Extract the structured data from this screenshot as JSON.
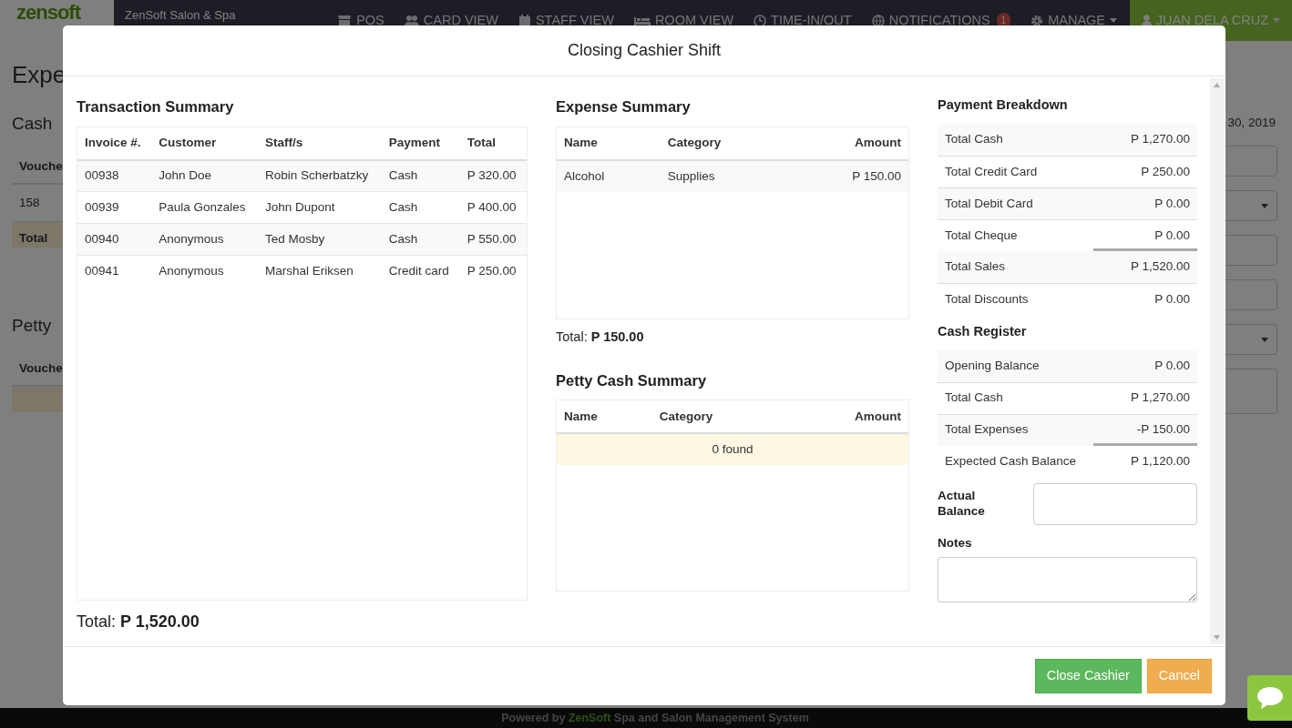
{
  "navbar": {
    "logo": "zensoft",
    "brand": "ZenSoft Salon & Spa",
    "items": [
      {
        "label": "POS"
      },
      {
        "label": "CARD VIEW"
      },
      {
        "label": "STAFF VIEW"
      },
      {
        "label": "ROOM VIEW"
      },
      {
        "label": "TIME-IN/OUT"
      },
      {
        "label": "NOTIFICATIONS",
        "badge": "1"
      },
      {
        "label": "MANAGE",
        "dropdown": true
      }
    ],
    "user": {
      "name": "JUAN DELA CRUZ",
      "dropdown": true
    }
  },
  "background_page": {
    "title": "Expe",
    "date": "30, 2019",
    "sections": [
      {
        "title": "Cash",
        "header": "Vouche",
        "rows": [
          "158"
        ],
        "total_label": "Total"
      },
      {
        "title": "Petty",
        "header": "Vouche",
        "empty_notice": true
      }
    ],
    "form_controls": [
      {
        "kind": "input"
      },
      {
        "kind": "select"
      },
      {
        "kind": "input"
      },
      {
        "kind": "input"
      },
      {
        "kind": "select"
      },
      {
        "kind": "textarea"
      }
    ]
  },
  "modal": {
    "title": "Closing Cashier Shift",
    "transaction_summary": {
      "title": "Transaction Summary",
      "columns": [
        {
          "label": "Invoice #."
        },
        {
          "label": "Customer"
        },
        {
          "label": "Staff/s"
        },
        {
          "label": "Payment"
        },
        {
          "label": "Total"
        }
      ],
      "rows": [
        [
          "00938",
          "John Doe",
          "Robin Scherbatzky",
          "Cash",
          "P 320.00"
        ],
        [
          "00939",
          "Paula Gonzales",
          "John Dupont",
          "Cash",
          "P 400.00"
        ],
        [
          "00940",
          "Anonymous",
          "Ted Mosby",
          "Cash",
          "P 550.00"
        ],
        [
          "00941",
          "Anonymous",
          "Marshal Eriksen",
          "Credit card",
          "P 250.00"
        ]
      ],
      "total": "Total: **P 1,520.00**"
    },
    "expense_summary": {
      "title": "Expense Summary",
      "columns": [
        {
          "label": "Name",
          "kind": "text"
        },
        {
          "label": "Category",
          "kind": "text"
        },
        {
          "label": "Amount",
          "kind": "amount"
        }
      ],
      "rows": [
        [
          "Alcohol",
          "Supplies",
          "P 150.00"
        ]
      ],
      "total": "Total: **P 150.00**"
    },
    "petty_cash_summary": {
      "title": "Petty Cash Summary",
      "columns": [
        {
          "label": "Name",
          "kind": "text"
        },
        {
          "label": "Category",
          "kind": "text"
        },
        {
          "label": "Amount",
          "kind": "amount"
        }
      ],
      "empty_message": "0 found"
    },
    "payment_breakdown": {
      "title": "Payment Breakdown",
      "rows": [
        {
          "label": "Total Cash",
          "value": "P 1,270.00",
          "kind": "item"
        },
        {
          "label": "Total Credit Card",
          "value": "P 250.00",
          "kind": "item"
        },
        {
          "label": "Total Debit Card",
          "value": "P 0.00",
          "kind": "item"
        },
        {
          "label": "Total Cheque",
          "value": "P 0.00",
          "kind": "item"
        },
        {
          "label": "Total Sales",
          "value": "P 1,520.00",
          "kind": "sum"
        },
        {
          "label": "Total Discounts",
          "value": "P 0.00",
          "kind": "item"
        }
      ]
    },
    "cash_register": {
      "title": "Cash Register",
      "rows": [
        {
          "label": "Opening Balance",
          "value": "P 0.00",
          "kind": "item"
        },
        {
          "label": "Total Cash",
          "value": "P 1,270.00",
          "kind": "item"
        },
        {
          "label": "Total Expenses",
          "value": "-P 150.00",
          "kind": "item"
        },
        {
          "label": "Expected Cash Balance",
          "value": "P 1,120.00",
          "kind": "sum"
        }
      ]
    },
    "actual_balance": {
      "label": "Actual Balance"
    },
    "notes": {
      "label": "Notes"
    },
    "buttons": [
      {
        "label": "Close Cashier",
        "kind": "success"
      },
      {
        "label": "Cancel",
        "kind": "warning"
      }
    ]
  },
  "footer": {
    "prefix": "Powered by",
    "link": "ZenSoft",
    "suffix": "Spa and Salon Management System"
  }
}
